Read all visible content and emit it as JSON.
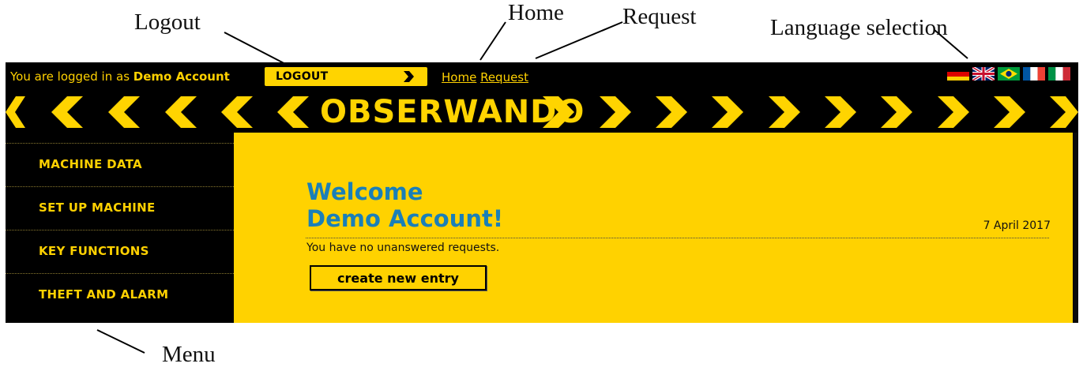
{
  "annotations": {
    "logout": "Logout",
    "home": "Home",
    "request": "Request",
    "language": "Language selection",
    "menu": "Menu"
  },
  "topbar": {
    "logged_in_prefix": "You are logged in as ",
    "account_name": "Demo Account",
    "logout_label": "LOGOUT",
    "home_link": "Home",
    "request_link": "Request",
    "flags": [
      "german-flag-icon",
      "uk-flag-icon",
      "brazil-flag-icon",
      "france-flag-icon",
      "italy-flag-icon"
    ]
  },
  "banner": {
    "logo": "OBSERWANDO"
  },
  "sidebar": {
    "items": [
      {
        "label": "MACHINE DATA"
      },
      {
        "label": "SET UP MACHINE"
      },
      {
        "label": "KEY FUNCTIONS"
      },
      {
        "label": "THEFT AND ALARM"
      }
    ]
  },
  "main": {
    "welcome_line1": "Welcome",
    "welcome_line2": "Demo Account!",
    "date": "7 April 2017",
    "no_requests": "You have no unanswered requests.",
    "create_button": "create new entry"
  },
  "colors": {
    "accent_yellow": "#ffd200",
    "heading_blue": "#1a7fb8",
    "frame_black": "#000000"
  }
}
